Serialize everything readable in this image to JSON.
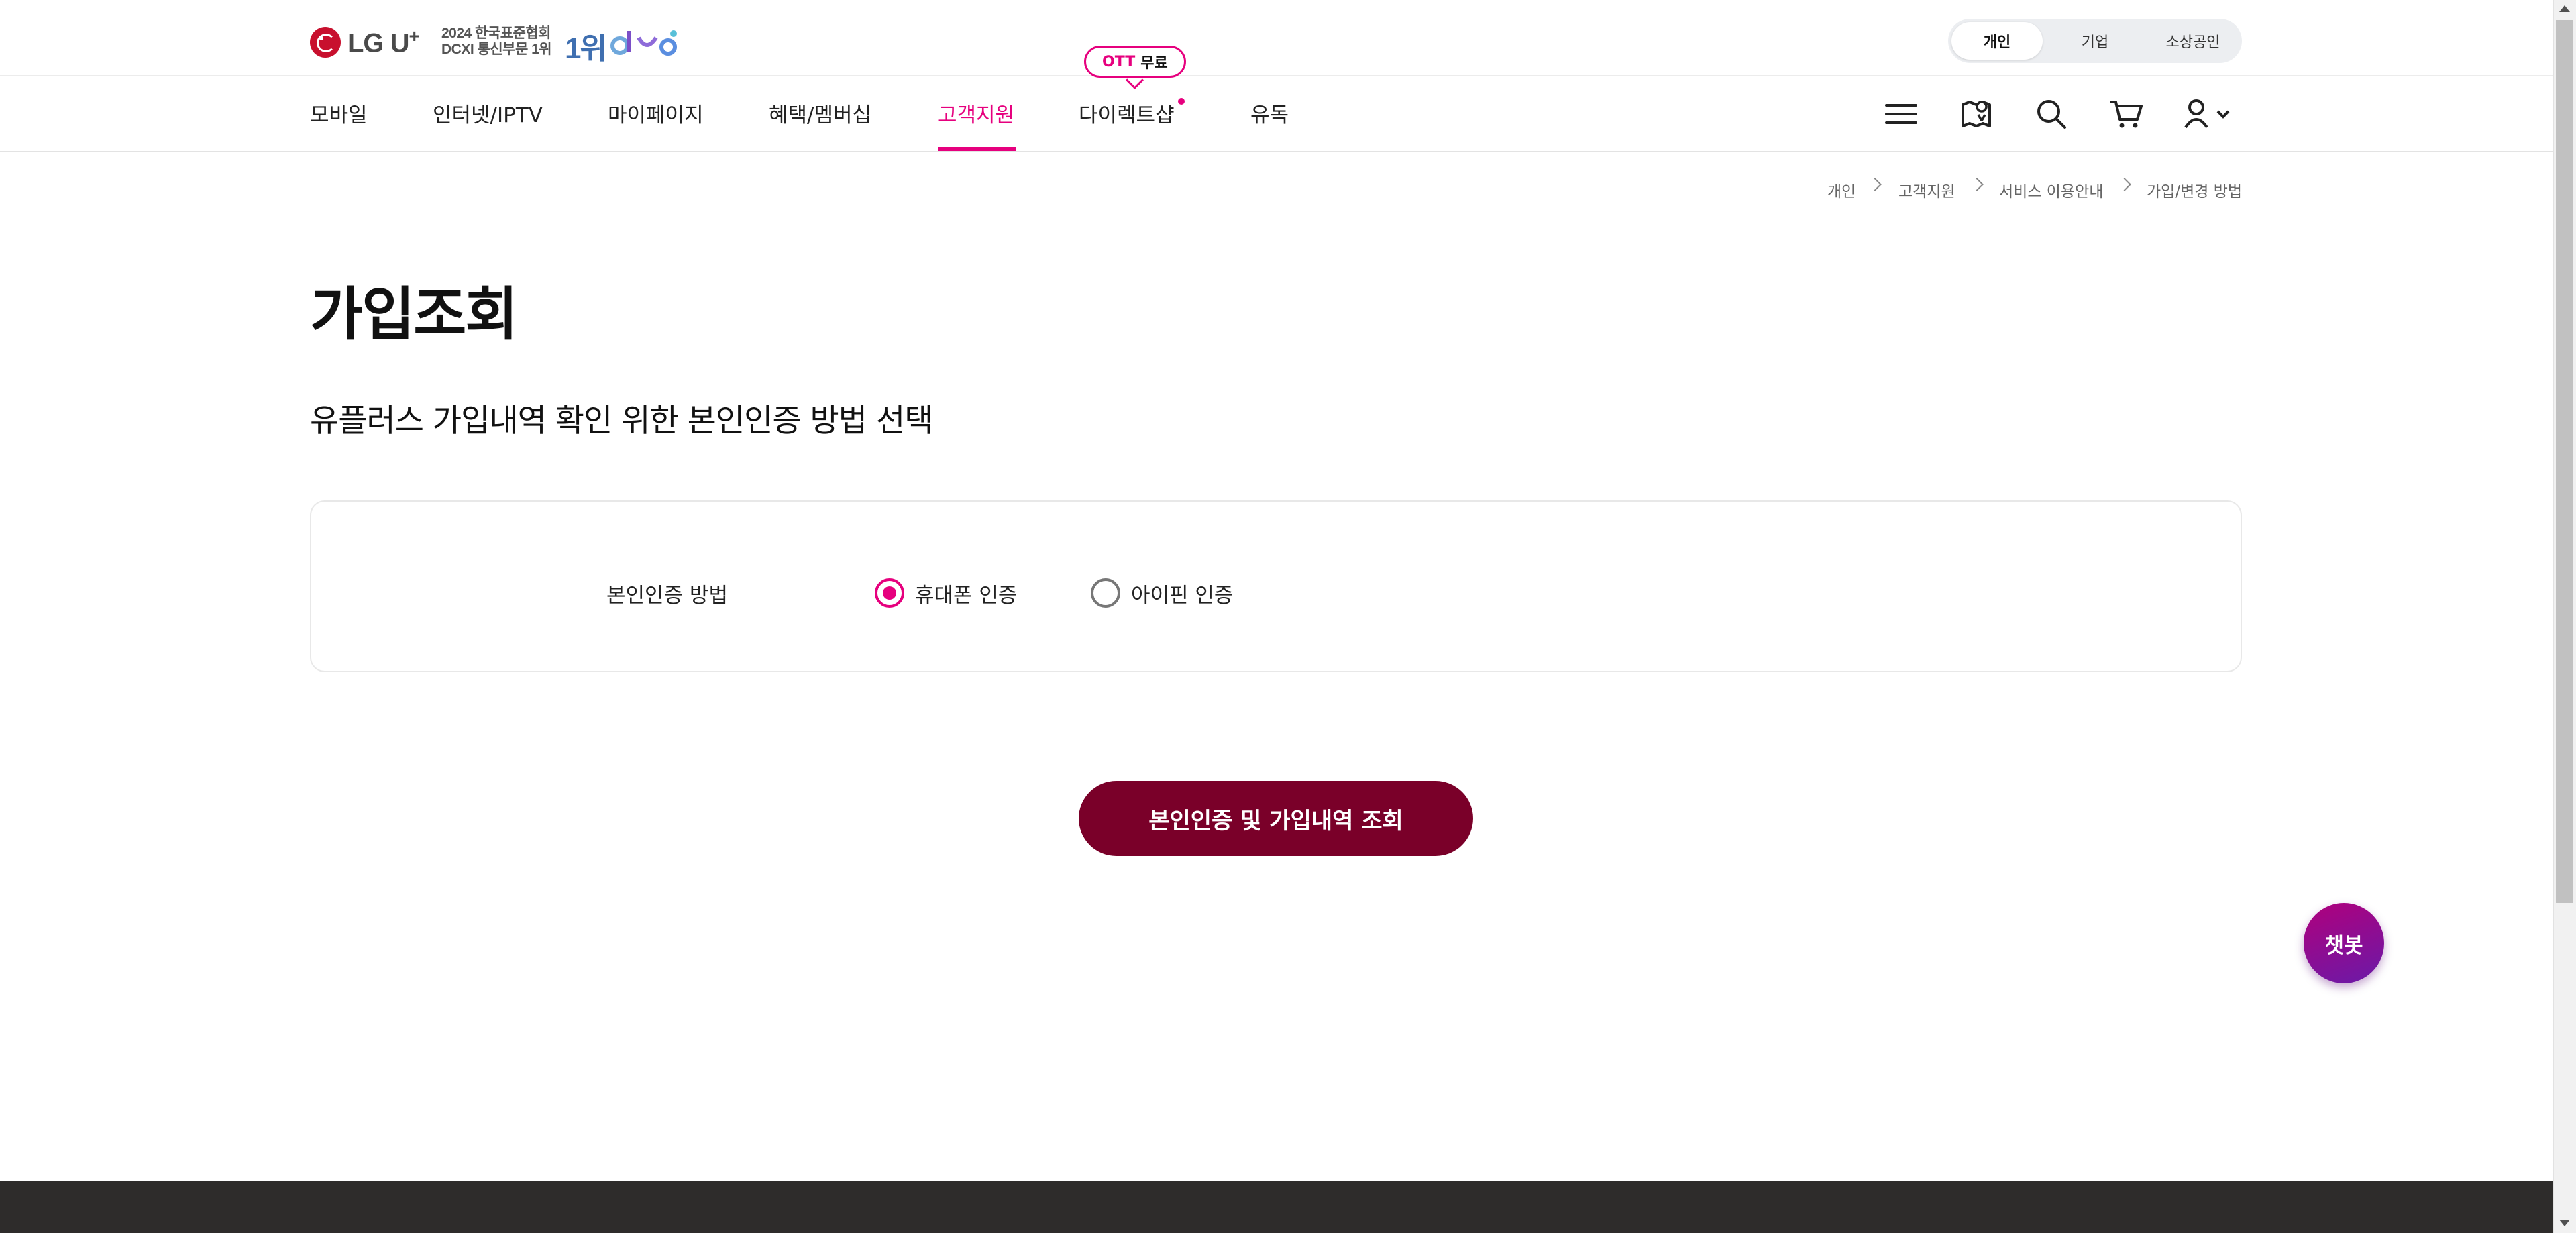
{
  "header": {
    "logo_text": "LG U",
    "logo_plus": "+",
    "award_line1": "2024 한국표준협회",
    "award_line2": "DCXI 통신부문 1위",
    "award_rank": "1위",
    "audience_tabs": [
      {
        "label": "개인",
        "active": true
      },
      {
        "label": "기업",
        "active": false
      },
      {
        "label": "소상공인",
        "active": false
      }
    ]
  },
  "nav": {
    "items": [
      {
        "label": "모바일"
      },
      {
        "label": "인터넷/IPTV"
      },
      {
        "label": "마이페이지"
      },
      {
        "label": "혜택/멤버십"
      },
      {
        "label": "고객지원",
        "active": true
      },
      {
        "label": "다이렉트샵",
        "has_dot": true
      },
      {
        "label": "유독"
      }
    ],
    "badge_prefix": "OTT",
    "badge_text": "무료",
    "icons": [
      "menu-icon",
      "store-icon",
      "search-icon",
      "cart-icon",
      "user-icon"
    ]
  },
  "breadcrumb": [
    "개인",
    "고객지원",
    "서비스 이용안내",
    "가입/변경 방법"
  ],
  "page": {
    "title": "가입조회",
    "subtitle": "유플러스 가입내역 확인 위한 본인인증 방법 선택"
  },
  "auth": {
    "label": "본인인증 방법",
    "options": [
      {
        "label": "휴대폰 인증",
        "selected": true
      },
      {
        "label": "아이핀 인증",
        "selected": false
      }
    ]
  },
  "cta_label": "본인인증 및 가입내역 조회",
  "chatbot_label": "챗봇",
  "colors": {
    "accent": "#e6007e",
    "cta": "#7a0029",
    "footer": "#2e2c2b"
  }
}
